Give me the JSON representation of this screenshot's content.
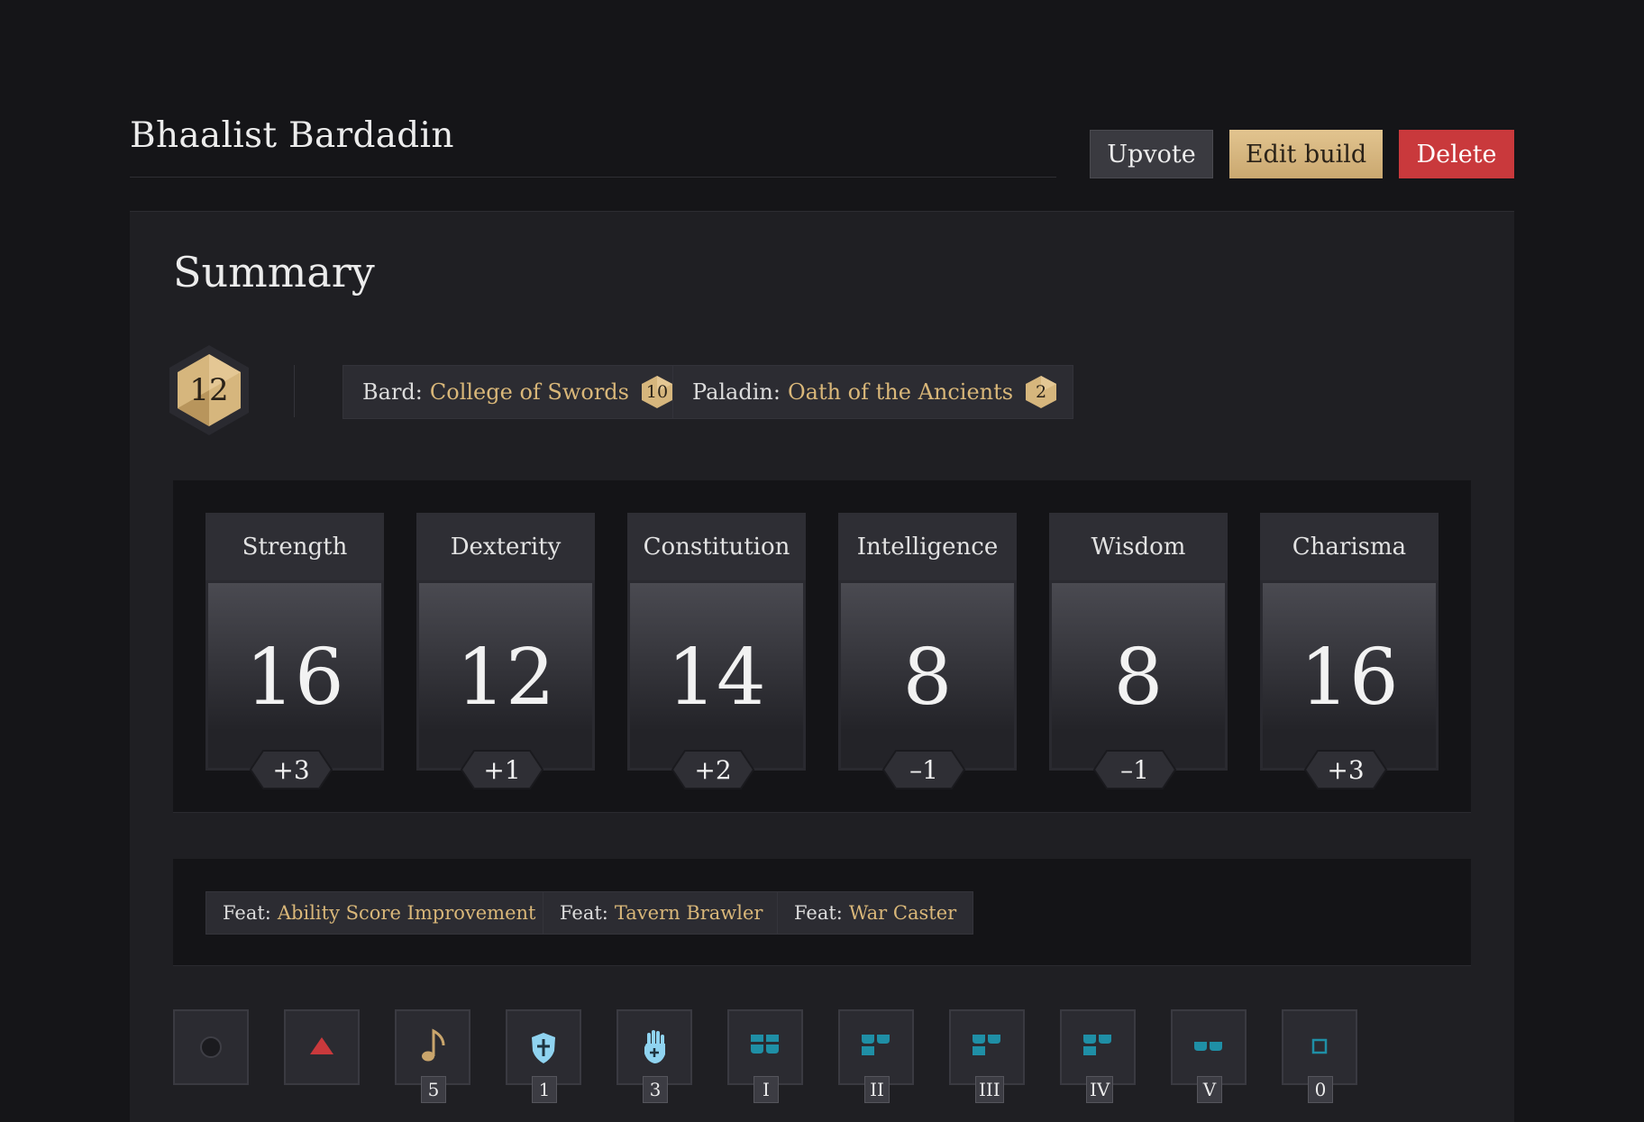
{
  "build": {
    "title": "Bhaalist Bardadin"
  },
  "actions": {
    "upvote": "Upvote",
    "edit": "Edit build",
    "delete": "Delete"
  },
  "summary": {
    "heading": "Summary",
    "level": "12",
    "classes": [
      {
        "label": "Bard:",
        "subclass": "College of Swords",
        "level": "10"
      },
      {
        "label": "Paladin:",
        "subclass": "Oath of the Ancients",
        "level": "2"
      }
    ]
  },
  "abilities": [
    {
      "name": "Strength",
      "score": "16",
      "modifier": "+3"
    },
    {
      "name": "Dexterity",
      "score": "12",
      "modifier": "+1"
    },
    {
      "name": "Constitution",
      "score": "14",
      "modifier": "+2"
    },
    {
      "name": "Intelligence",
      "score": "8",
      "modifier": "–1"
    },
    {
      "name": "Wisdom",
      "score": "8",
      "modifier": "–1"
    },
    {
      "name": "Charisma",
      "score": "16",
      "modifier": "+3"
    }
  ],
  "feats": [
    {
      "label": "Feat:",
      "name": "Ability Score Improvement"
    },
    {
      "label": "Feat:",
      "name": "Tavern Brawler"
    },
    {
      "label": "Feat:",
      "name": "War Caster"
    }
  ],
  "resources": [
    {
      "icon": "action-circle-icon",
      "count": ""
    },
    {
      "icon": "bonus-action-triangle-icon",
      "count": ""
    },
    {
      "icon": "bardic-inspiration-note-icon",
      "count": "5"
    },
    {
      "icon": "channel-oath-shield-icon",
      "count": "1"
    },
    {
      "icon": "lay-on-hands-icon",
      "count": "3"
    },
    {
      "icon": "spell-slot-level-1-icon",
      "count": "I"
    },
    {
      "icon": "spell-slot-level-2-icon",
      "count": "II"
    },
    {
      "icon": "spell-slot-level-3-icon",
      "count": "III"
    },
    {
      "icon": "spell-slot-level-4-icon",
      "count": "IV"
    },
    {
      "icon": "spell-slot-level-5-icon",
      "count": "V"
    },
    {
      "icon": "cantrip-slot-icon",
      "count": "0"
    }
  ],
  "colors": {
    "accent_gold": "#d9b779",
    "delete_red": "#c9393c",
    "spell_teal": "#1f8fa6",
    "ability_icon_blue": "#8fd3f0"
  }
}
